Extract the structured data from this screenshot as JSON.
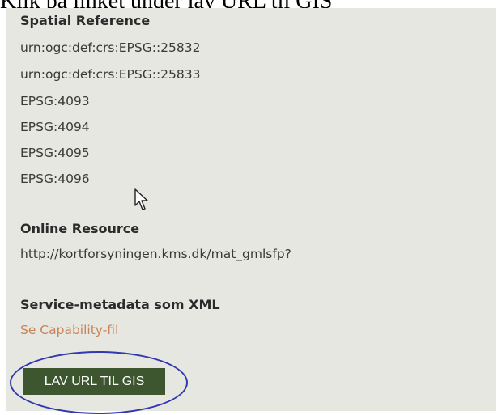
{
  "caption": "Klik på linket under lav URL til GIS",
  "spatial_reference": {
    "heading": "Spatial Reference",
    "values": [
      "urn:ogc:def:crs:EPSG::25832",
      "urn:ogc:def:crs:EPSG::25833",
      "EPSG:4093",
      "EPSG:4094",
      "EPSG:4095",
      "EPSG:4096"
    ]
  },
  "online_resource": {
    "heading": "Online Resource",
    "url": "http://kortforsyningen.kms.dk/mat_gmlsfp?"
  },
  "service_metadata": {
    "heading": "Service-metadata som XML",
    "link_label": "Se Capability-fil"
  },
  "action": {
    "button_label": "LAV URL TIL GIS"
  },
  "colors": {
    "panel_bg": "#e5e7e0",
    "button_bg": "#3d5630",
    "link": "#c8835a",
    "annotation": "#3238b0"
  }
}
